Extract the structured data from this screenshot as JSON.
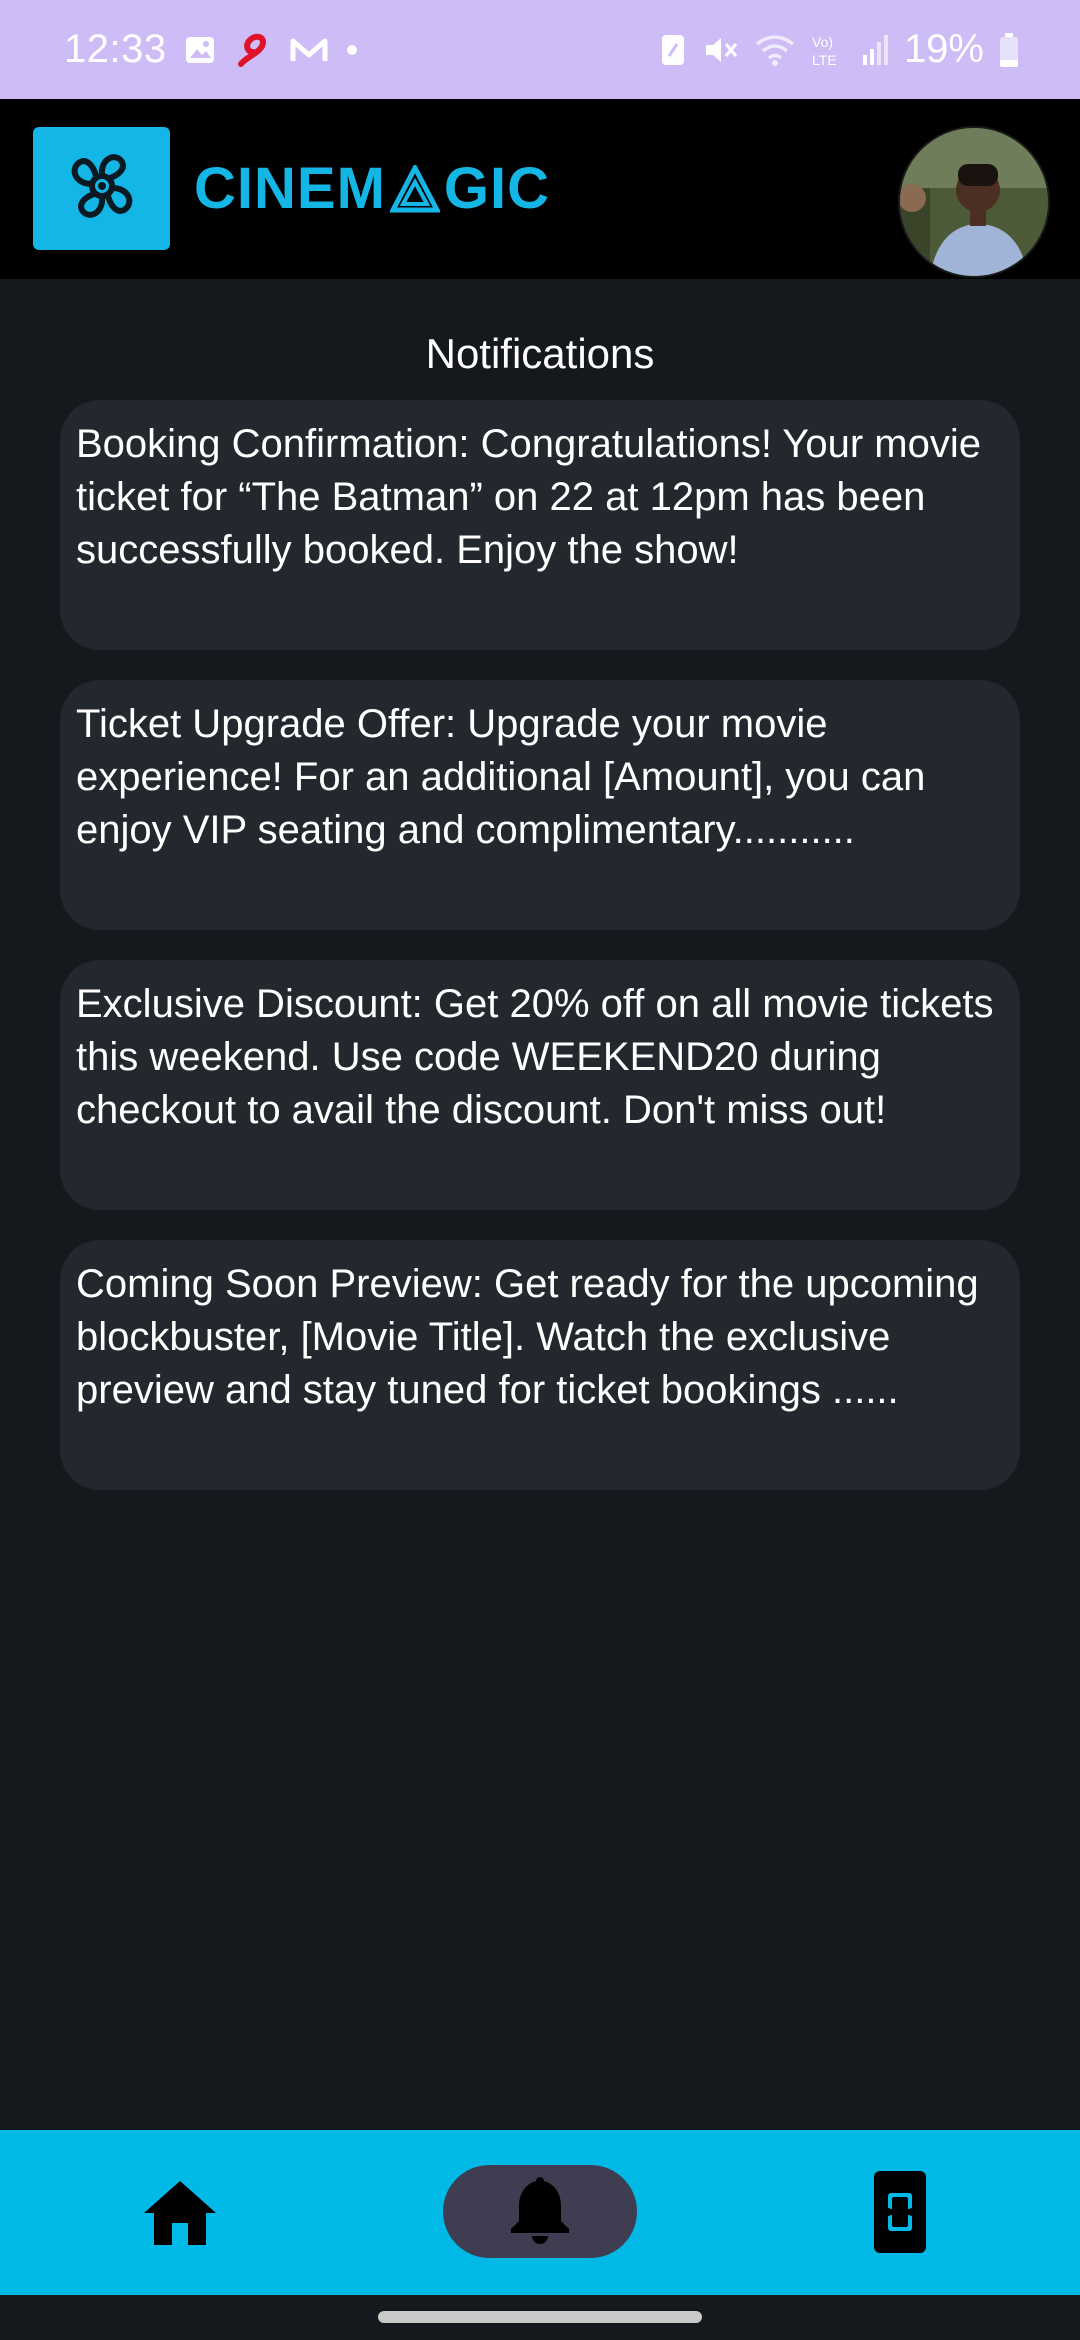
{
  "status_bar": {
    "time": "12:33",
    "battery": "19%",
    "left_icons": [
      "gallery-icon",
      "airtel-icon",
      "gmail-icon",
      "dot-icon"
    ],
    "right_icons": [
      "nfc-icon",
      "mute-icon",
      "wifi-icon",
      "volte-icon",
      "signal-icon",
      "battery-icon"
    ]
  },
  "header": {
    "brand_left": "CINEM",
    "brand_right": "GIC",
    "accent_color": "#14b6e6"
  },
  "notifications": {
    "title": "Notifications",
    "items": [
      {
        "text": "Booking Confirmation: Congratulations! Your movie ticket for “The Batman” on 22 at 12pm has been successfully booked. Enjoy the show!"
      },
      {
        "text": "Ticket Upgrade Offer: Upgrade your movie experience! For an additional [Amount], you can enjoy VIP seating and complimentary..........."
      },
      {
        "text": "Exclusive Discount: Get 20% off on all movie tickets this weekend. Use code WEEKEND20 during checkout to avail the discount. Don't miss out!"
      },
      {
        "text": "Coming Soon Preview: Get ready for the upcoming blockbuster, [Movie Title]. Watch the exclusive preview and stay tuned for ticket bookings ......"
      }
    ]
  },
  "bottom_nav": {
    "items": [
      {
        "icon": "home-icon",
        "active": false
      },
      {
        "icon": "bell-icon",
        "active": true
      },
      {
        "icon": "ticket-icon",
        "active": false
      }
    ],
    "bar_color": "#00b9e6",
    "active_pill_color": "#3e3d52"
  }
}
